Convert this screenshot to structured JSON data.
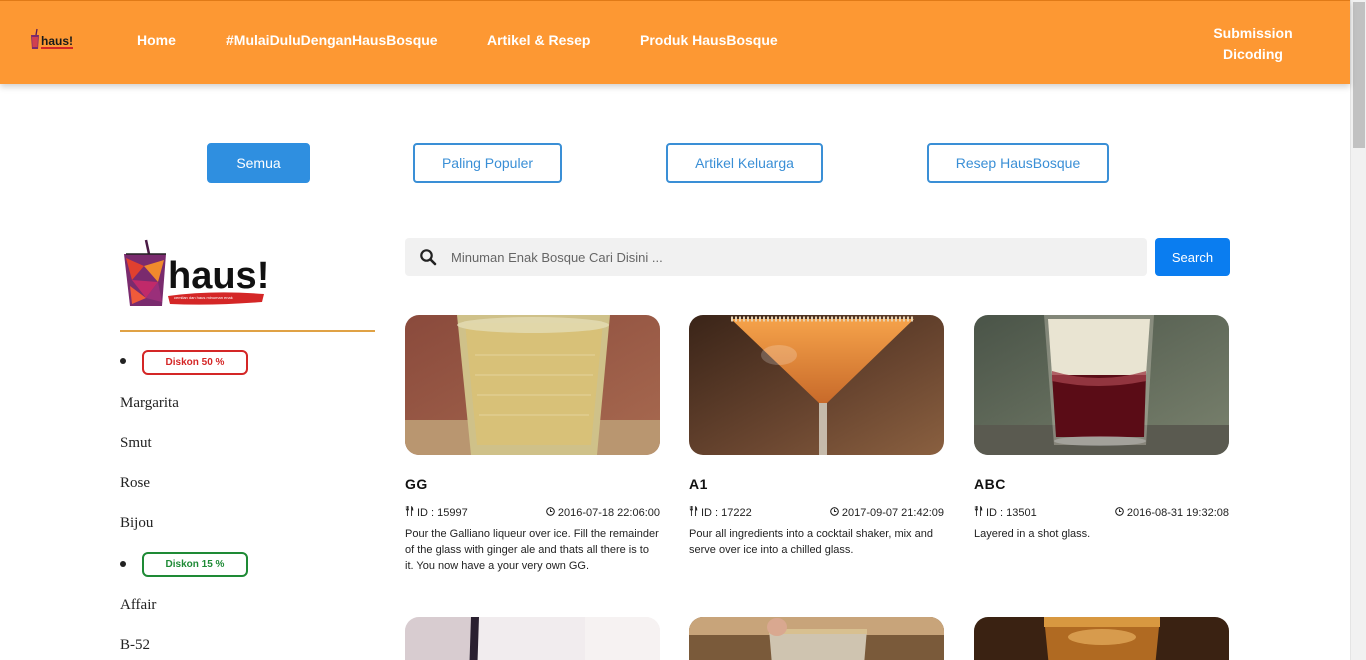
{
  "nav": {
    "logo_text": "haus!",
    "links": [
      "Home",
      "#MulaiDuluDenganHausBosque",
      "Artikel & Resep",
      "Produk HausBosque"
    ],
    "submission_line1": "Submission",
    "submission_line2": "Dicoding",
    "bg_color": "#fd9833"
  },
  "filters": [
    "Semua",
    "Paling Populer",
    "Artikel Keluarga",
    "Resep HausBosque"
  ],
  "sidebar": {
    "logo_text": "haus!",
    "logo_tagline": "cemilan dan haus minuman enak",
    "group1": {
      "badge": "Diskon 50 %",
      "items": [
        "Margarita",
        "Smut",
        "Rose",
        "Bijou"
      ]
    },
    "group2": {
      "badge": "Diskon 15 %",
      "items": [
        "Affair",
        "B-52"
      ]
    }
  },
  "search": {
    "placeholder": "Minuman Enak Bosque Cari Disini ...",
    "button_label": "Search"
  },
  "cards": [
    {
      "title": "GG",
      "id": "ID : 15997",
      "date": "2016-07-18 22:06:00",
      "desc": "Pour the Galliano liqueur over ice. Fill the remainder of the glass with ginger ale and thats all there is to it. You now have a your very own GG."
    },
    {
      "title": "A1",
      "id": "ID : 17222",
      "date": "2017-09-07 21:42:09",
      "desc": "Pour all ingredients into a cocktail shaker, mix and serve over ice into a chilled glass."
    },
    {
      "title": "ABC",
      "id": "ID : 13501",
      "date": "2016-08-31 19:32:08",
      "desc": "Layered in a shot glass."
    }
  ],
  "icons": {
    "search": "search-icon",
    "meta_id": "utensils-icon",
    "meta_date": "clock-icon"
  },
  "colors": {
    "accent": "#fd9833",
    "primary": "#0a7df0",
    "discount50": "#d42626",
    "discount15": "#1e8a35"
  }
}
